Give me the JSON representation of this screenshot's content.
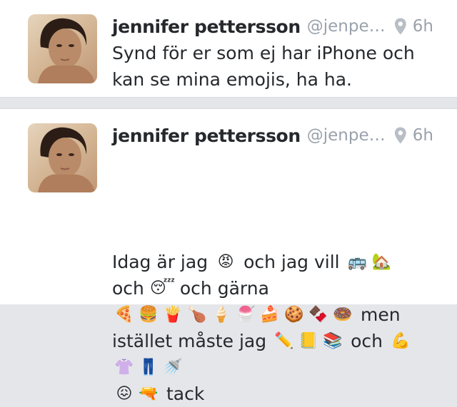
{
  "tweets": [
    {
      "author_name": "jennifer pettersson",
      "handle": "@jenpett…",
      "time": "6h",
      "location_icon": "location-pin-icon",
      "lines": [
        [
          {
            "t": "text",
            "v": "Synd för er som ej har iPhone och"
          }
        ],
        [
          {
            "t": "text",
            "v": "kan se mina emojis, ha ha."
          }
        ]
      ]
    },
    {
      "author_name": "jennifer pettersson",
      "handle": "@jenpett…",
      "time": "6h",
      "location_icon": "location-pin-icon",
      "lines": [
        [
          {
            "t": "text",
            "v": "Idag är jag"
          },
          {
            "t": "emoji",
            "v": "😡",
            "name": "angry-face"
          },
          {
            "t": "text",
            "v": "och jag vill"
          },
          {
            "t": "emoji",
            "v": "🚌",
            "name": "bus"
          },
          {
            "t": "emoji",
            "v": "🏡",
            "name": "house-with-garden"
          }
        ],
        [
          {
            "t": "text",
            "v": "och"
          },
          {
            "t": "emoji",
            "v": "😴",
            "name": "sleeping-face"
          },
          {
            "t": "text",
            "v": "och gärna"
          }
        ],
        [
          {
            "t": "emoji",
            "v": "🍕",
            "name": "pizza"
          },
          {
            "t": "emoji",
            "v": "🍔",
            "name": "hamburger"
          },
          {
            "t": "emoji",
            "v": "🍟",
            "name": "fries"
          },
          {
            "t": "emoji",
            "v": "🍗",
            "name": "poultry-leg"
          },
          {
            "t": "emoji",
            "v": "🍦",
            "name": "ice-cream"
          },
          {
            "t": "emoji",
            "v": "🍧",
            "name": "shaved-ice"
          },
          {
            "t": "emoji",
            "v": "🍰",
            "name": "shortcake"
          },
          {
            "t": "emoji",
            "v": "🍪",
            "name": "cookie"
          },
          {
            "t": "emoji",
            "v": "🍫",
            "name": "chocolate-bar"
          },
          {
            "t": "emoji",
            "v": "🍩",
            "name": "doughnut"
          },
          {
            "t": "text",
            "v": "men"
          }
        ],
        [
          {
            "t": "text",
            "v": "istället måste jag"
          },
          {
            "t": "emoji",
            "v": "✏️",
            "name": "pencil"
          },
          {
            "t": "emoji",
            "v": "📒",
            "name": "ledger"
          },
          {
            "t": "emoji",
            "v": "📚",
            "name": "books"
          },
          {
            "t": "text",
            "v": "och"
          },
          {
            "t": "emoji",
            "v": "💪",
            "name": "flexed-biceps"
          }
        ],
        [
          {
            "t": "emoji",
            "v": "👚",
            "name": "blouse"
          },
          {
            "t": "emoji",
            "v": "👖",
            "name": "jeans"
          },
          {
            "t": "emoji",
            "v": "🚿",
            "name": "shower"
          }
        ],
        [
          {
            "t": "emoji",
            "v": "😖",
            "name": "confounded-face"
          },
          {
            "t": "emoji",
            "v": "🔫",
            "name": "pistol"
          },
          {
            "t": "text",
            "v": "tack"
          }
        ]
      ]
    }
  ]
}
